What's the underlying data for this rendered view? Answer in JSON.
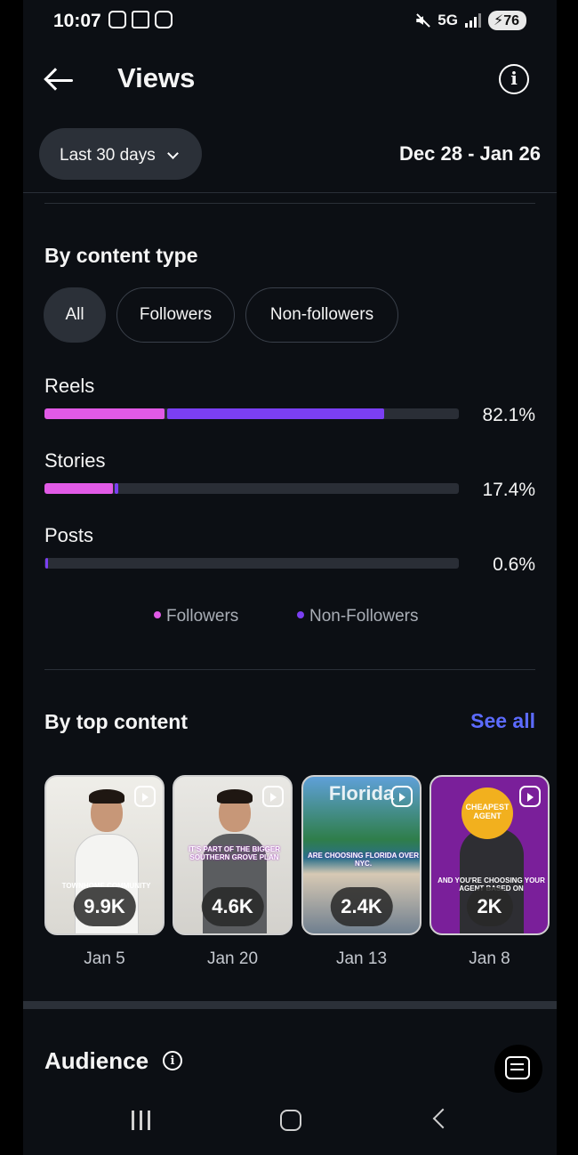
{
  "status_bar": {
    "time": "10:07",
    "network": "5G",
    "battery": "76"
  },
  "header": {
    "title": "Views"
  },
  "filters": {
    "range_label": "Last 30 days",
    "date_range": "Dec 28 - Jan 26"
  },
  "content_type": {
    "title": "By content type",
    "tabs": [
      "All",
      "Followers",
      "Non-followers"
    ],
    "active_tab": "All",
    "rows": [
      {
        "label": "Reels",
        "percent": "82.1%",
        "followers_fraction": 0.29,
        "non_followers_fraction": 0.53
      },
      {
        "label": "Stories",
        "percent": "17.4%",
        "followers_fraction": 0.165,
        "non_followers_fraction": 0.009
      },
      {
        "label": "Posts",
        "percent": "0.6%",
        "followers_fraction": 0.0,
        "non_followers_fraction": 0.006
      }
    ],
    "legend": [
      "Followers",
      "Non-Followers"
    ],
    "colors": {
      "followers": "#e15ae6",
      "non_followers": "#7b3ff2"
    }
  },
  "top_content": {
    "title": "By top content",
    "see_all": "See all",
    "items": [
      {
        "views": "9.9K",
        "date": "Jan 5",
        "caption": "TOWNHOME COMMUNITY"
      },
      {
        "views": "4.6K",
        "date": "Jan 20",
        "caption": "IT'S PART OF THE BIGGER SOUTHERN GROVE PLAN"
      },
      {
        "views": "2.4K",
        "date": "Jan 13",
        "heading": "Florida",
        "caption": "ARE CHOOSING FLORIDA OVER NYC."
      },
      {
        "views": "2K",
        "date": "Jan 8",
        "badge": "CHEAPEST AGENT",
        "caption": "AND YOU'RE CHOOSING YOUR AGENT BASED ON"
      }
    ]
  },
  "audience": {
    "title": "Audience"
  },
  "icons": {
    "back": "arrow-left-icon",
    "info": "info-icon",
    "dropdown": "chevron-down-icon",
    "reel": "reel-icon",
    "scan": "scan-text-icon"
  }
}
